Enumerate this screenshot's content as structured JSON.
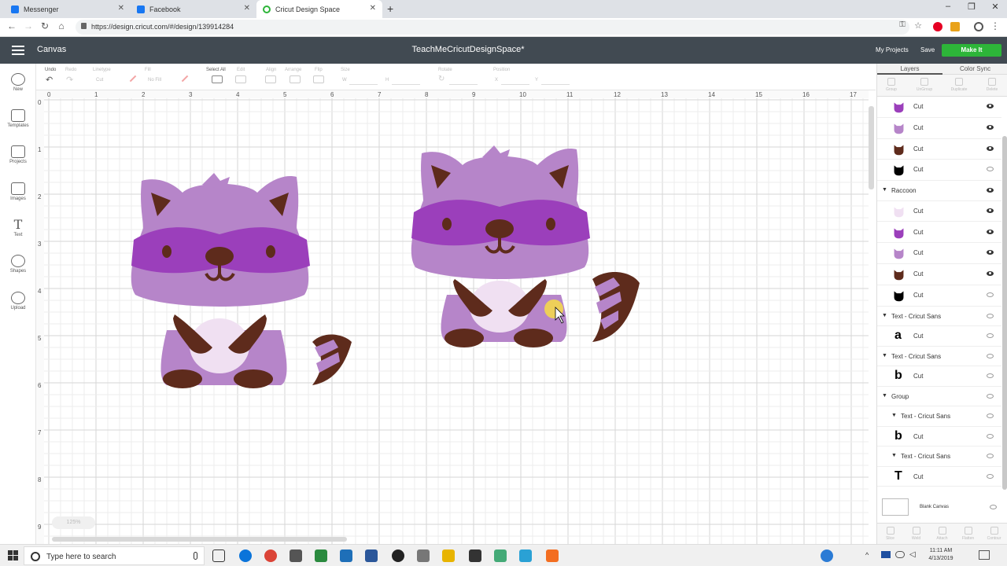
{
  "browser": {
    "tabs": [
      {
        "title": "Messenger",
        "color": "#1877f2"
      },
      {
        "title": "Facebook",
        "color": "#1877f2"
      },
      {
        "title": "Cricut Design Space",
        "color": "#2db539",
        "active": true
      }
    ],
    "url": "https://design.cricut.com/#/design/139914284"
  },
  "header": {
    "section": "Canvas",
    "project_name": "TeachMeCricutDesignSpace*",
    "my_projects": "My Projects",
    "save": "Save",
    "make_it": "Make It",
    "make_it_color": "#2db539"
  },
  "toolbar": {
    "undo": "Undo",
    "redo": "Redo",
    "linetype": "Linetype",
    "linetype_value": "Cut",
    "fill": "Fill",
    "fill_value": "No Fill",
    "select_all": "Select All",
    "edit": "Edit",
    "align": "Align",
    "arrange": "Arrange",
    "flip": "Flip",
    "size": "Size",
    "size_w": "W",
    "size_h": "H",
    "rotate": "Rotate",
    "position": "Position",
    "pos_x": "X",
    "pos_y": "Y"
  },
  "sidebar": {
    "items": [
      {
        "label": "New"
      },
      {
        "label": "Templates"
      },
      {
        "label": "Projects"
      },
      {
        "label": "Images"
      },
      {
        "label": "Text"
      },
      {
        "label": "Shapes"
      },
      {
        "label": "Upload"
      }
    ]
  },
  "canvas": {
    "ruler_top": [
      "0",
      "1",
      "2",
      "3",
      "4",
      "5",
      "6",
      "7",
      "8",
      "9",
      "10",
      "11",
      "12",
      "13",
      "14",
      "15",
      "16",
      "17"
    ],
    "ruler_left": [
      "0",
      "1",
      "2",
      "3",
      "4",
      "5",
      "6",
      "7",
      "8",
      "9"
    ],
    "zoom": "125%",
    "raccoon_colors": {
      "body": "#b685c9",
      "mask": "#9b3fbb",
      "brown": "#5e2b1c",
      "belly": "#f0e0f2",
      "nose": "#5e2b1c"
    }
  },
  "layers_panel": {
    "tabs": [
      "Layers",
      "Color Sync"
    ],
    "tools": [
      "Group",
      "UnGroup",
      "Duplicate",
      "Delete"
    ],
    "rows": [
      {
        "kind": "layer",
        "label": "Cut",
        "thumb": "mask-thumb",
        "eye": true
      },
      {
        "kind": "layer",
        "label": "Cut",
        "thumb": "body-thumb",
        "eye": true
      },
      {
        "kind": "layer",
        "label": "Cut",
        "thumb": "brown-thumb",
        "eye": true
      },
      {
        "kind": "layer",
        "label": "Cut",
        "thumb": "black-thumb",
        "eye": false
      },
      {
        "kind": "group",
        "label": "Raccoon",
        "eye": true
      },
      {
        "kind": "layer",
        "label": "Cut",
        "thumb": "belly-thumb",
        "eye": true
      },
      {
        "kind": "layer",
        "label": "Cut",
        "thumb": "mask-thumb",
        "eye": true
      },
      {
        "kind": "layer",
        "label": "Cut",
        "thumb": "body-thumb",
        "eye": true
      },
      {
        "kind": "layer",
        "label": "Cut",
        "thumb": "brown-thumb",
        "eye": true
      },
      {
        "kind": "layer",
        "label": "Cut",
        "thumb": "black-thumb",
        "eye": false
      },
      {
        "kind": "group",
        "label": "Text - Cricut Sans",
        "eye": false
      },
      {
        "kind": "text",
        "label": "Cut",
        "glyph": "a",
        "eye": false
      },
      {
        "kind": "group",
        "label": "Text - Cricut Sans",
        "eye": false
      },
      {
        "kind": "text",
        "label": "Cut",
        "glyph": "b",
        "eye": false
      },
      {
        "kind": "group",
        "label": "Group",
        "eye": false
      },
      {
        "kind": "subgroup",
        "label": "Text - Cricut Sans",
        "eye": false
      },
      {
        "kind": "text",
        "label": "Cut",
        "glyph": "b",
        "eye": false
      },
      {
        "kind": "subgroup",
        "label": "Text - Cricut Sans",
        "eye": false
      },
      {
        "kind": "text",
        "label": "Cut",
        "glyph": "T",
        "eye": false
      }
    ],
    "blank_canvas": "Blank Canvas",
    "bottom_tools": [
      "Slice",
      "Weld",
      "Attach",
      "Flatten",
      "Contour"
    ]
  },
  "taskbar": {
    "search_placeholder": "Type here to search",
    "time": "11:11 AM",
    "date": "4/13/2019"
  }
}
